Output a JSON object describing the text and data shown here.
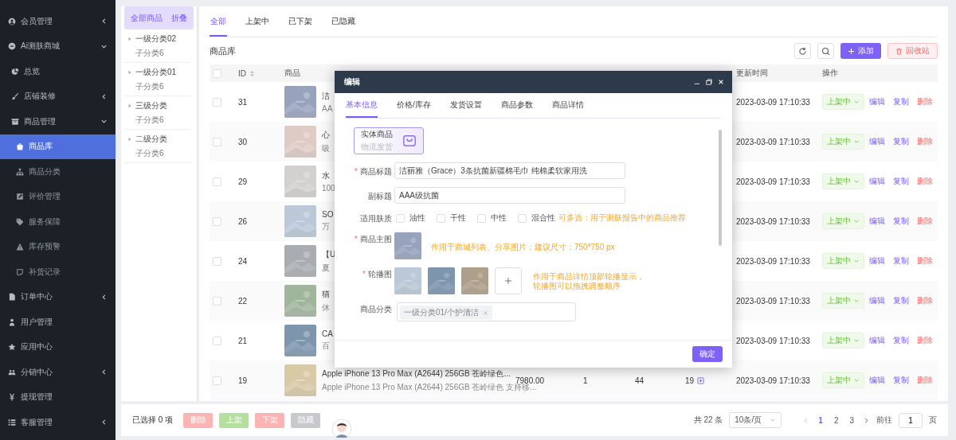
{
  "sidebar": {
    "items": [
      {
        "label": "会员管理",
        "expanded": false,
        "selected": false
      },
      {
        "label": "Ai测肤商城",
        "expanded": true,
        "selected": false,
        "children": [
          {
            "label": "总览",
            "selected": false
          },
          {
            "label": "店铺装修",
            "expanded": false,
            "selected": false
          },
          {
            "label": "商品管理",
            "expanded": true,
            "selected": false,
            "children": [
              {
                "label": "商品库",
                "selected": true
              },
              {
                "label": "商品分类",
                "selected": false
              },
              {
                "label": "评价管理",
                "selected": false
              },
              {
                "label": "服务保障",
                "selected": false
              },
              {
                "label": "库存预警",
                "selected": false
              },
              {
                "label": "补货记录",
                "selected": false
              }
            ]
          }
        ]
      },
      {
        "label": "订单中心",
        "expanded": false,
        "selected": false
      },
      {
        "label": "用户管理",
        "selected": false
      },
      {
        "label": "应用中心",
        "selected": false
      },
      {
        "label": "分销中心",
        "expanded": false,
        "selected": false
      },
      {
        "label": "提现管理",
        "selected": false
      },
      {
        "label": "客服管理",
        "expanded": false,
        "selected": false
      }
    ]
  },
  "category_panel": {
    "header": {
      "label": "全部商品",
      "selected": true
    },
    "collapse_link": "折叠",
    "items": [
      {
        "label": "一级分类02",
        "sub": "子分类6",
        "expanded": false
      },
      {
        "label": "一级分类01",
        "sub": "子分类6",
        "expanded": false
      },
      {
        "label": "三级分类",
        "sub": "子分类6",
        "expanded": false
      },
      {
        "label": "二级分类",
        "sub": "子分类6",
        "expanded": false
      }
    ]
  },
  "tabs": [
    {
      "label": "全部",
      "selected": true
    },
    {
      "label": "上架中",
      "selected": false
    },
    {
      "label": "已下架",
      "selected": false
    },
    {
      "label": "已隐藏",
      "selected": false
    }
  ],
  "toolbar": {
    "title": "商品库",
    "add_button": "添加",
    "recycle_button": "回收站"
  },
  "table": {
    "select_all": {
      "checked": false
    },
    "columns": {
      "id": "ID",
      "product": "商品",
      "updated": "更新时间",
      "actions": "操作"
    },
    "rows": [
      {
        "checked": false,
        "id": "31",
        "title": "洁",
        "subtitle": "AA",
        "updated": "2023-03-09 17:10:33",
        "status": "上架中",
        "actions": [
          "编辑",
          "复制",
          "删除"
        ]
      },
      {
        "checked": false,
        "id": "30",
        "title": "心",
        "subtitle": "吸",
        "updated": "2023-03-09 17:10:33",
        "status": "上架中",
        "actions": [
          "编辑",
          "复制",
          "删除"
        ]
      },
      {
        "checked": false,
        "id": "29",
        "title": "水",
        "subtitle": "100",
        "updated": "2023-03-09 17:10:33",
        "status": "上架中",
        "actions": [
          "编辑",
          "复制",
          "删除"
        ]
      },
      {
        "checked": false,
        "id": "26",
        "title": "SO",
        "subtitle": "万",
        "updated": "2023-03-09 17:10:33",
        "status": "上架中",
        "actions": [
          "编辑",
          "复制",
          "删除"
        ]
      },
      {
        "checked": false,
        "id": "24",
        "title": "【U",
        "subtitle": "夏",
        "updated": "2023-03-09 17:10:33",
        "status": "上架中",
        "actions": [
          "编辑",
          "复制",
          "删除"
        ]
      },
      {
        "checked": false,
        "id": "22",
        "title": "猫",
        "subtitle": "休",
        "updated": "2023-03-09 17:10:33",
        "status": "上架中",
        "actions": [
          "编辑",
          "复制",
          "删除"
        ]
      },
      {
        "checked": false,
        "id": "21",
        "title": "CA",
        "subtitle": "百",
        "updated": "2023-03-09 17:10:33",
        "status": "上架中",
        "actions": [
          "编辑",
          "复制",
          "删除"
        ]
      },
      {
        "checked": false,
        "id": "19",
        "title": "Apple iPhone 13 Pro Max (A2644) 256GB 苍岭绿色...",
        "subtitle": "Apple iPhone 13 Pro Max (A2644) 256GB 苍岭绿色 支持移...",
        "column_4": "7980.00",
        "column_5": "1",
        "column_6": "44",
        "column_7": "19",
        "updated": "2023-03-09 17:10:33",
        "status": "上架中",
        "actions": [
          "编辑",
          "复制",
          "删除"
        ]
      }
    ]
  },
  "bottom_bar": {
    "selection": "已选择 0 项",
    "buttons": [
      {
        "label": "删除",
        "kind": "danger"
      },
      {
        "label": "上架",
        "kind": "success"
      },
      {
        "label": "下架",
        "kind": "danger"
      },
      {
        "label": "隐藏",
        "kind": "neutral"
      }
    ],
    "total": "共 22 条",
    "page_size": "10条/页",
    "pages": [
      {
        "label": "1",
        "selected": true
      },
      {
        "label": "2",
        "selected": false
      },
      {
        "label": "3",
        "selected": false
      }
    ],
    "goto_label": "前往",
    "goto_value": "1",
    "goto_suffix": "页"
  },
  "dialog": {
    "title": "编辑",
    "required_mark": "*",
    "tabs": [
      {
        "label": "基本信息",
        "selected": true
      },
      {
        "label": "价格/库存",
        "selected": false
      },
      {
        "label": "发货设置",
        "selected": false
      },
      {
        "label": "商品参数",
        "selected": false
      },
      {
        "label": "商品详情",
        "selected": false
      }
    ],
    "type_card": {
      "title": "实体商品",
      "subtitle": "物流发货",
      "selected": true
    },
    "title_field": {
      "label": "商品标题",
      "required": true,
      "value": "洁丽雅（Grace）3条抗菌新疆棉毛巾 纯棉柔软家用洗"
    },
    "subtitle_field": {
      "label": "副标题",
      "value": "AAA级抗菌"
    },
    "skin_field": {
      "label": "适用肤质",
      "options": [
        {
          "label": "油性",
          "checked": false
        },
        {
          "label": "干性",
          "checked": false
        },
        {
          "label": "中性",
          "checked": false
        },
        {
          "label": "混合性",
          "checked": false
        }
      ],
      "hint": "可多选：用于测肤报告中的商品推荐"
    },
    "main_image_field": {
      "label": "商品主图",
      "required": true,
      "hint": "作用于商城列表、分享图片；建议尺寸：750*750 px"
    },
    "carousel_field": {
      "label": "轮播图",
      "required": true,
      "hint": [
        "作用于商品详情顶部轮播显示，",
        "轮播图可以拖拽调整顺序"
      ]
    },
    "category_field": {
      "label": "商品分类",
      "tags": [
        "一级分类01/个护清洁"
      ]
    },
    "confirm_button": "确定"
  }
}
